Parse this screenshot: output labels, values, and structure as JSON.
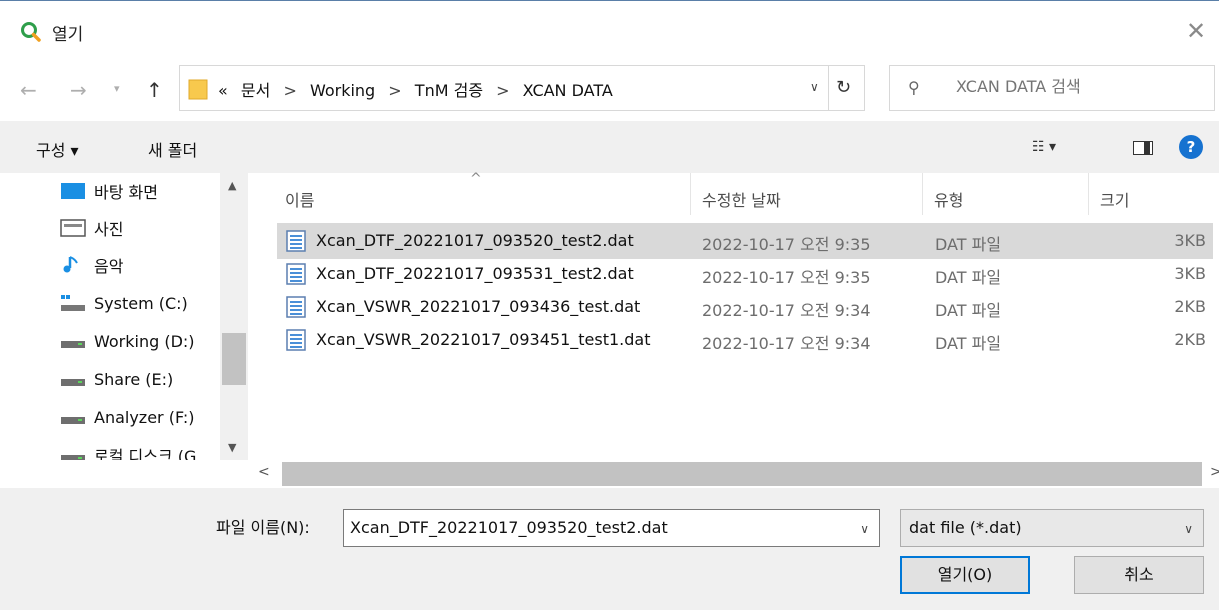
{
  "window": {
    "title": "열기"
  },
  "nav": {
    "address_crumbs": [
      "«",
      "문서",
      ">",
      "Working",
      ">",
      "TnM 검증",
      ">",
      "XCAN DATA"
    ],
    "search_placeholder": "XCAN DATA 검색"
  },
  "toolbar": {
    "organize_label": "구성 ▾",
    "new_folder_label": "새 폴더"
  },
  "sidebar": {
    "items": [
      {
        "label": "바탕 화면",
        "icon": "desktop-icon"
      },
      {
        "label": "사진",
        "icon": "pictures-icon"
      },
      {
        "label": "음악",
        "icon": "music-icon"
      },
      {
        "label": "System (C:)",
        "icon": "system-drive-icon"
      },
      {
        "label": "Working (D:)",
        "icon": "drive-icon"
      },
      {
        "label": "Share (E:)",
        "icon": "drive-icon"
      },
      {
        "label": "Analyzer (F:)",
        "icon": "drive-icon"
      },
      {
        "label": "로컬 디스크 (G",
        "icon": "drive-icon"
      }
    ]
  },
  "files": {
    "columns": {
      "name": "이름",
      "date": "수정한 날짜",
      "type": "유형",
      "size": "크기"
    },
    "rows": [
      {
        "name": "Xcan_DTF_20221017_093520_test2.dat",
        "date": "2022-10-17 오전 9:35",
        "type": "DAT 파일",
        "size": "3KB",
        "selected": true
      },
      {
        "name": "Xcan_DTF_20221017_093531_test2.dat",
        "date": "2022-10-17 오전 9:35",
        "type": "DAT 파일",
        "size": "3KB",
        "selected": false
      },
      {
        "name": "Xcan_VSWR_20221017_093436_test.dat",
        "date": "2022-10-17 오전 9:34",
        "type": "DAT 파일",
        "size": "2KB",
        "selected": false
      },
      {
        "name": "Xcan_VSWR_20221017_093451_test1.dat",
        "date": "2022-10-17 오전 9:34",
        "type": "DAT 파일",
        "size": "2KB",
        "selected": false
      }
    ]
  },
  "footer": {
    "filename_label": "파일 이름(N):",
    "filename_value": "Xcan_DTF_20221017_093520_test2.dat",
    "filetype_value": "dat file (*.dat)",
    "open_label": "열기(O)",
    "cancel_label": "취소"
  },
  "colors": {
    "accent": "#0078d7",
    "selection": "#d9d9d9",
    "help": "#1672d0",
    "folder": "#f8c94d"
  }
}
